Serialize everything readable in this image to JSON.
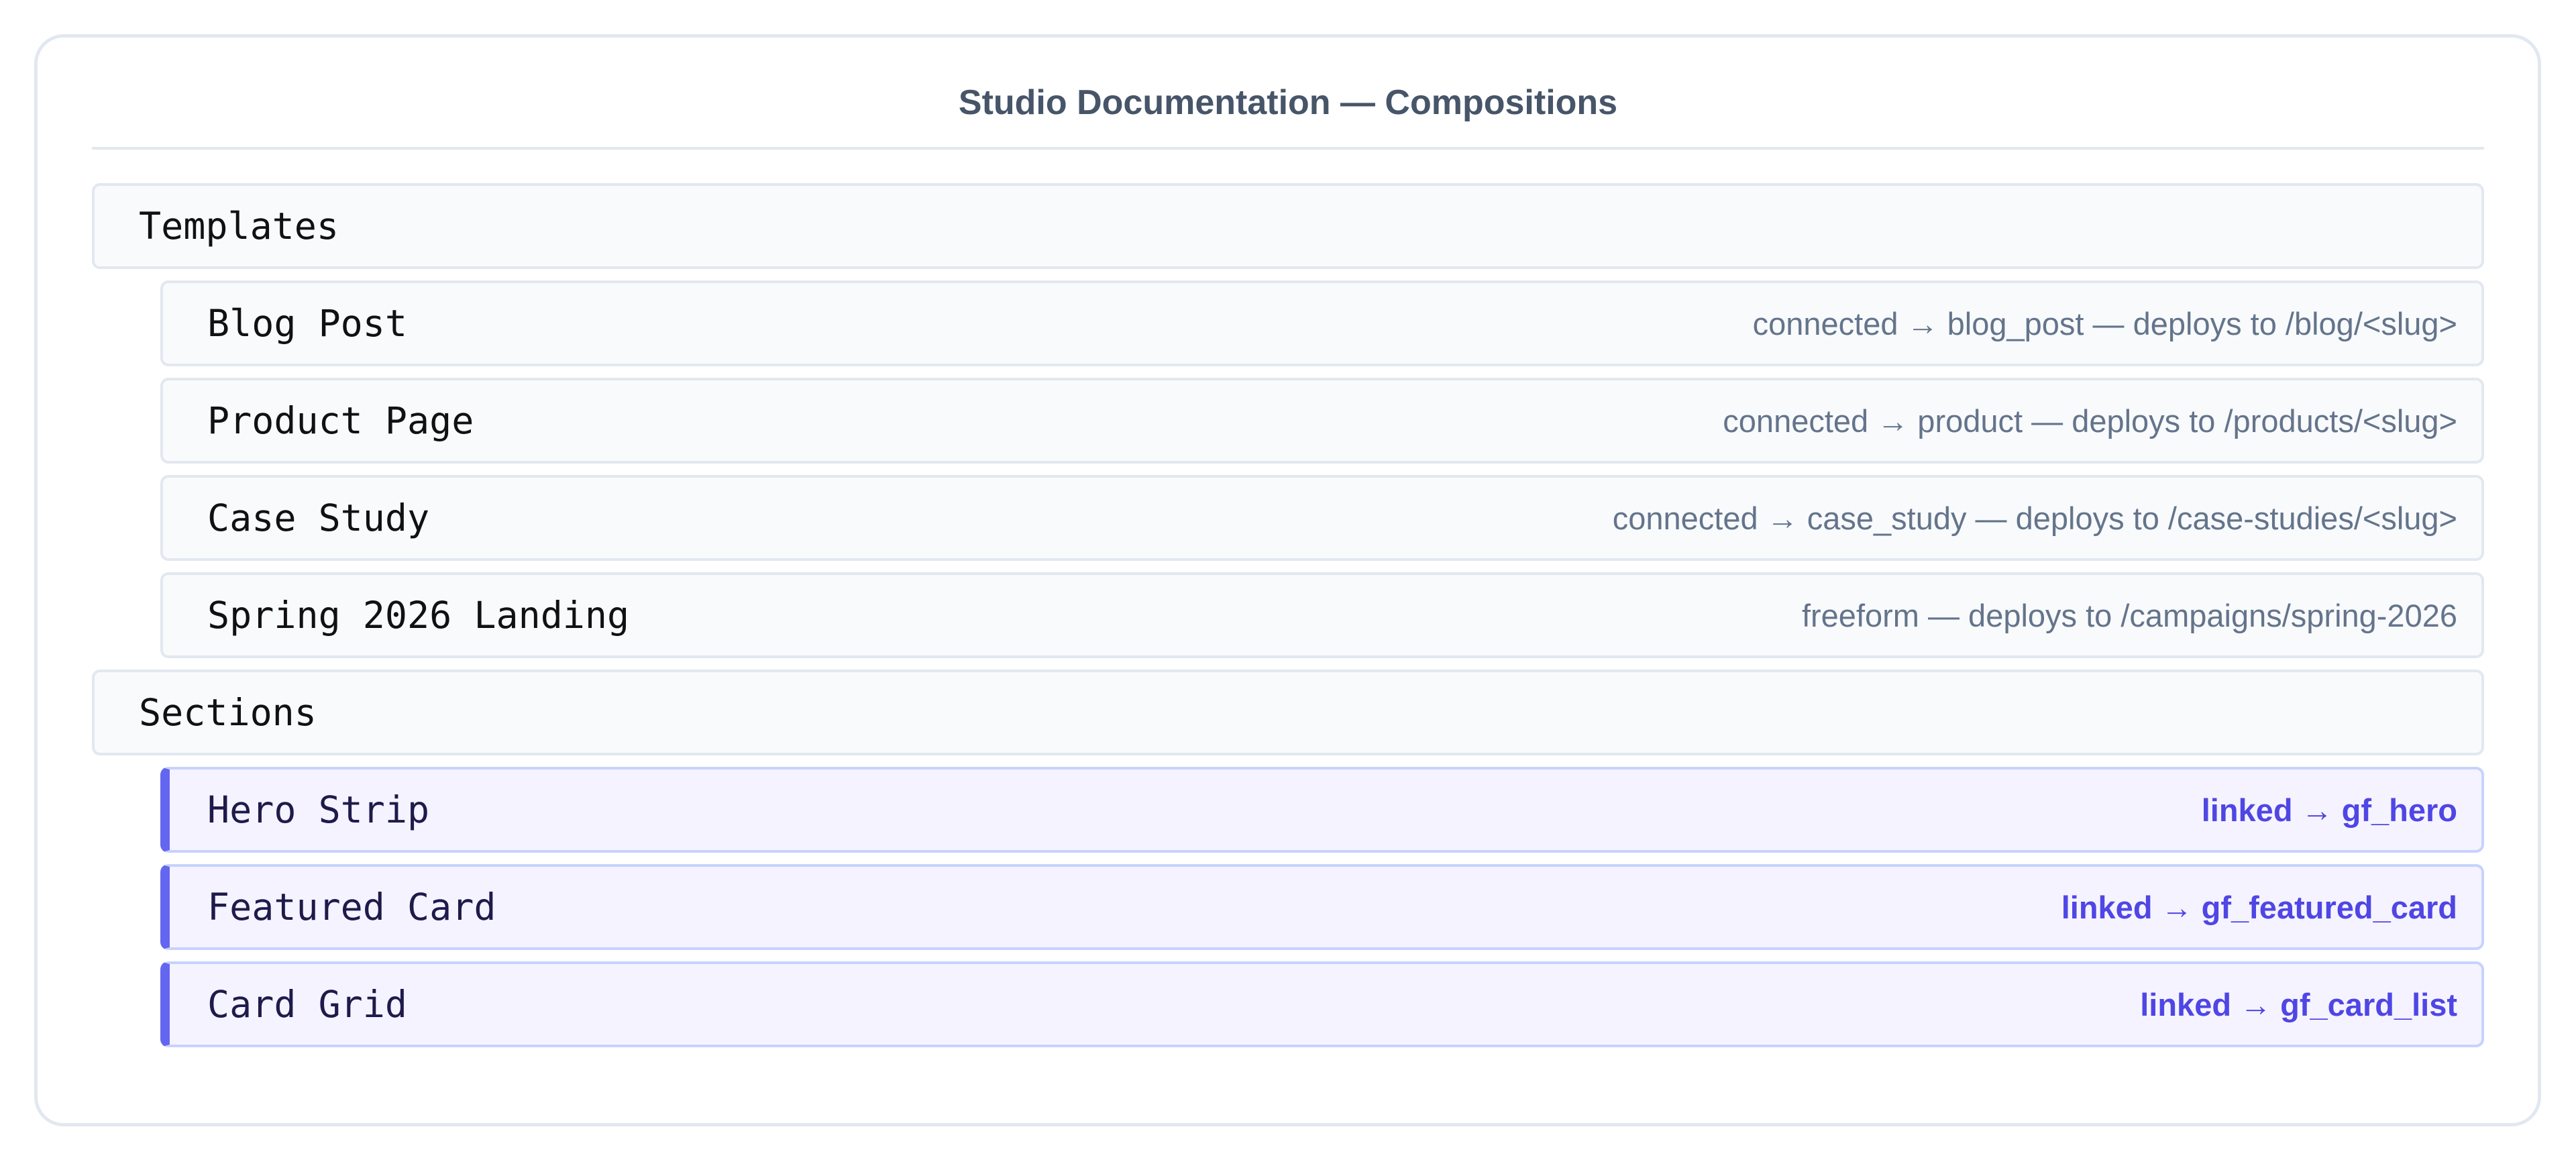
{
  "page": {
    "title": "Studio Documentation — Compositions"
  },
  "groups": [
    {
      "label": "Templates",
      "items": [
        {
          "name": "Blog Post",
          "meta": "connected → blog_post — deploys to /blog/<slug>"
        },
        {
          "name": "Product Page",
          "meta": "connected → product — deploys to /products/<slug>"
        },
        {
          "name": "Case Study",
          "meta": "connected → case_study — deploys to /case-studies/<slug>"
        },
        {
          "name": "Spring 2026 Landing",
          "meta": "freeform — deploys to /campaigns/spring-2026"
        }
      ]
    },
    {
      "label": "Sections",
      "items": [
        {
          "name": "Hero Strip",
          "meta": "linked → gf_hero"
        },
        {
          "name": "Featured Card",
          "meta": "linked → gf_featured_card"
        },
        {
          "name": "Card Grid",
          "meta": "linked → gf_card_list"
        }
      ]
    }
  ],
  "colors": {
    "panel_border": "#e2e8f0",
    "row_background": "#f8fafc",
    "linked_accent": "#6366f1",
    "linked_background": "#f5f3ff",
    "linked_text": "#4f46e5",
    "muted_text": "#64748b",
    "title_text": "#475569"
  }
}
